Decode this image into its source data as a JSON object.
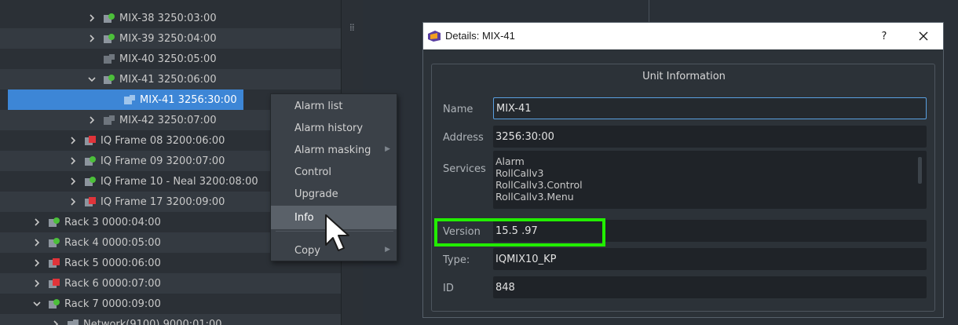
{
  "tree": {
    "rows": [
      {
        "label": "MIX-38 3250:03:00"
      },
      {
        "label": "MIX-39 3250:04:00"
      },
      {
        "label": "MIX-40 3250:05:00"
      },
      {
        "label": "MIX-41 3250:06:00"
      },
      {
        "label": "MIX-41 3256:30:00"
      },
      {
        "label": "MIX-42 3250:07:00"
      },
      {
        "label": "IQ Frame 08 3200:06:00"
      },
      {
        "label": "IQ Frame 09 3200:07:00"
      },
      {
        "label": "IQ Frame 10 - Neal 3200:08:00"
      },
      {
        "label": "IQ Frame 17 3200:09:00"
      },
      {
        "label": "Rack 3 0000:04:00"
      },
      {
        "label": "Rack 4 0000:05:00"
      },
      {
        "label": "Rack 5 0000:06:00"
      },
      {
        "label": "Rack 6 0000:07:00"
      },
      {
        "label": "Rack 7 0000:09:00"
      },
      {
        "label": "Network(9100) 9000:01:00"
      }
    ]
  },
  "context_menu": {
    "items": [
      {
        "label": "Alarm list"
      },
      {
        "label": "Alarm history"
      },
      {
        "label": "Alarm masking"
      },
      {
        "label": "Control"
      },
      {
        "label": "Upgrade"
      },
      {
        "label": "Info"
      },
      {
        "label": "Copy"
      }
    ]
  },
  "dialog": {
    "title": "Details: MIX-41",
    "help": "?",
    "section_title": "Unit Information",
    "fields": {
      "name_label": "Name",
      "name_value": "MIX-41",
      "address_label": "Address",
      "address_value": "3256:30:00",
      "services_label": "Services",
      "services": [
        "Alarm",
        "RollCallv3",
        "RollCallv3.Control",
        "RollCallv3.Menu"
      ],
      "version_label": "Version",
      "version_value": "15.5 .97",
      "type_label": "Type:",
      "type_value": "IQMIX10_KP",
      "id_label": "ID",
      "id_value": "848"
    }
  },
  "colors": {
    "selection": "#3d86d6",
    "status_green": "#4cbf3a",
    "status_red": "#e0343a",
    "annotation_highlight": "#22ee00"
  }
}
